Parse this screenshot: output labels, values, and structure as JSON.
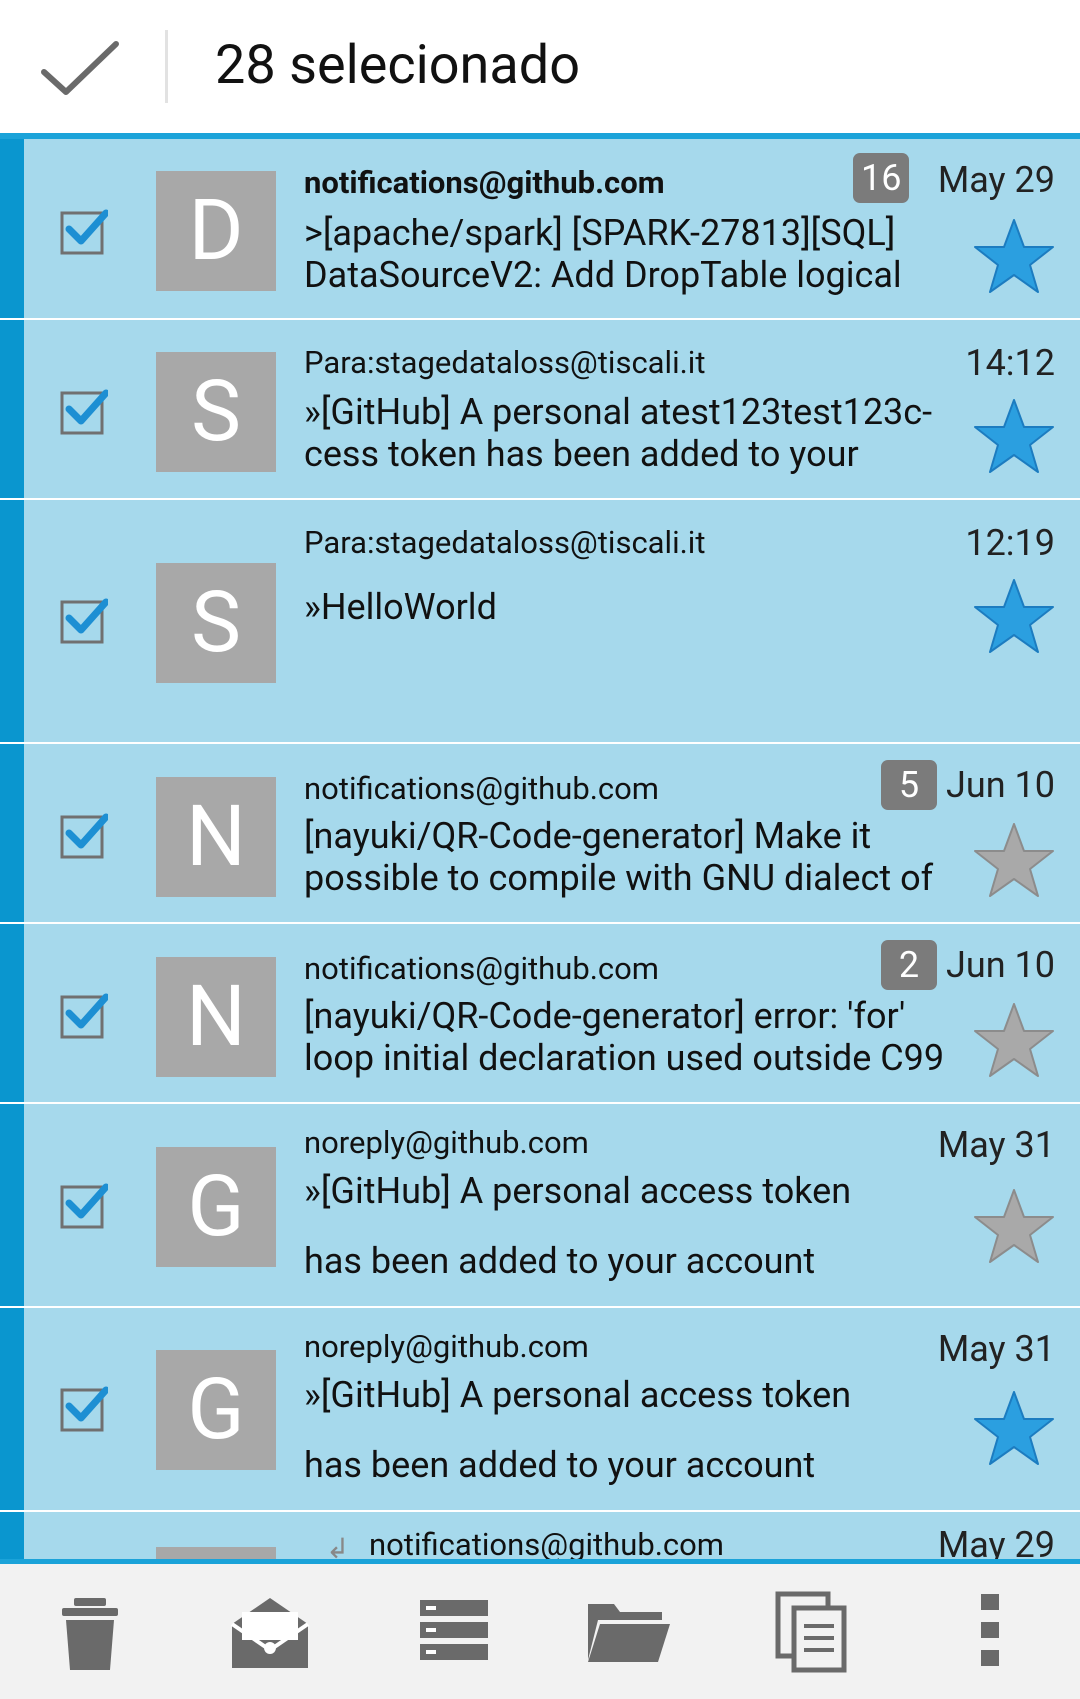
{
  "header": {
    "title": "28 selecionado"
  },
  "colors": {
    "accent_blue": "#1ba3d9",
    "row_selected_bg": "#a6d9ec",
    "row_accent_stripe": "#0a96cf",
    "avatar_bg": "#a8a8a8",
    "badge_bg": "#7b7b7b",
    "star_blue": "#2b9fe0",
    "star_gray": "#a9a9a9"
  },
  "messages": [
    {
      "avatar": "D",
      "sender": "notifications@github.com",
      "subject_1": ">[apache/spark] [SPARK-27813][SQL]",
      "subject_2": "DataSourceV2: Add DropTable logical",
      "badge": "16",
      "date": "May 29",
      "starred": true,
      "checked": true
    },
    {
      "avatar": "S",
      "sender": "Para:stagedataloss@tiscali.it",
      "subject_1": "»[GitHub] A personal atest123test123c-",
      "subject_2": "cess token has been added to your",
      "date": "14:12",
      "starred": true,
      "checked": true
    },
    {
      "avatar": "S",
      "sender": "Para:stagedataloss@tiscali.it",
      "subject_1": "»HelloWorld",
      "date": "12:19",
      "starred": true,
      "checked": true
    },
    {
      "avatar": "N",
      "sender": "notifications@github.com",
      "subject_1": "[nayuki/QR-Code-generator] Make it",
      "subject_2": "possible to compile with GNU dialect of",
      "badge": "5",
      "date": "Jun 10",
      "starred": false,
      "checked": true
    },
    {
      "avatar": "N",
      "sender": "notifications@github.com",
      "subject_1": "[nayuki/QR-Code-generator] error: 'for'",
      "subject_2": "loop initial declaration used outside C99",
      "badge": "2",
      "date": "Jun 10",
      "starred": false,
      "checked": true
    },
    {
      "avatar": "G",
      "sender": "noreply@github.com",
      "subject_1": "»[GitHub] A personal access token",
      "subject_2": "has been added to your account",
      "date": "May 31",
      "starred": false,
      "checked": true
    },
    {
      "avatar": "G",
      "sender": "noreply@github.com",
      "subject_1": "»[GitHub] A personal access token",
      "subject_2": "has been added to your account",
      "date": "May 31",
      "starred": true,
      "checked": true
    },
    {
      "sender": "notifications@github.com",
      "date": "May 29",
      "checked": true
    }
  ],
  "toolbar": {
    "icons": [
      "trash-icon",
      "open-envelope-icon",
      "archive-stack-icon",
      "folder-icon",
      "copy-icon",
      "more-vert-icon"
    ]
  }
}
